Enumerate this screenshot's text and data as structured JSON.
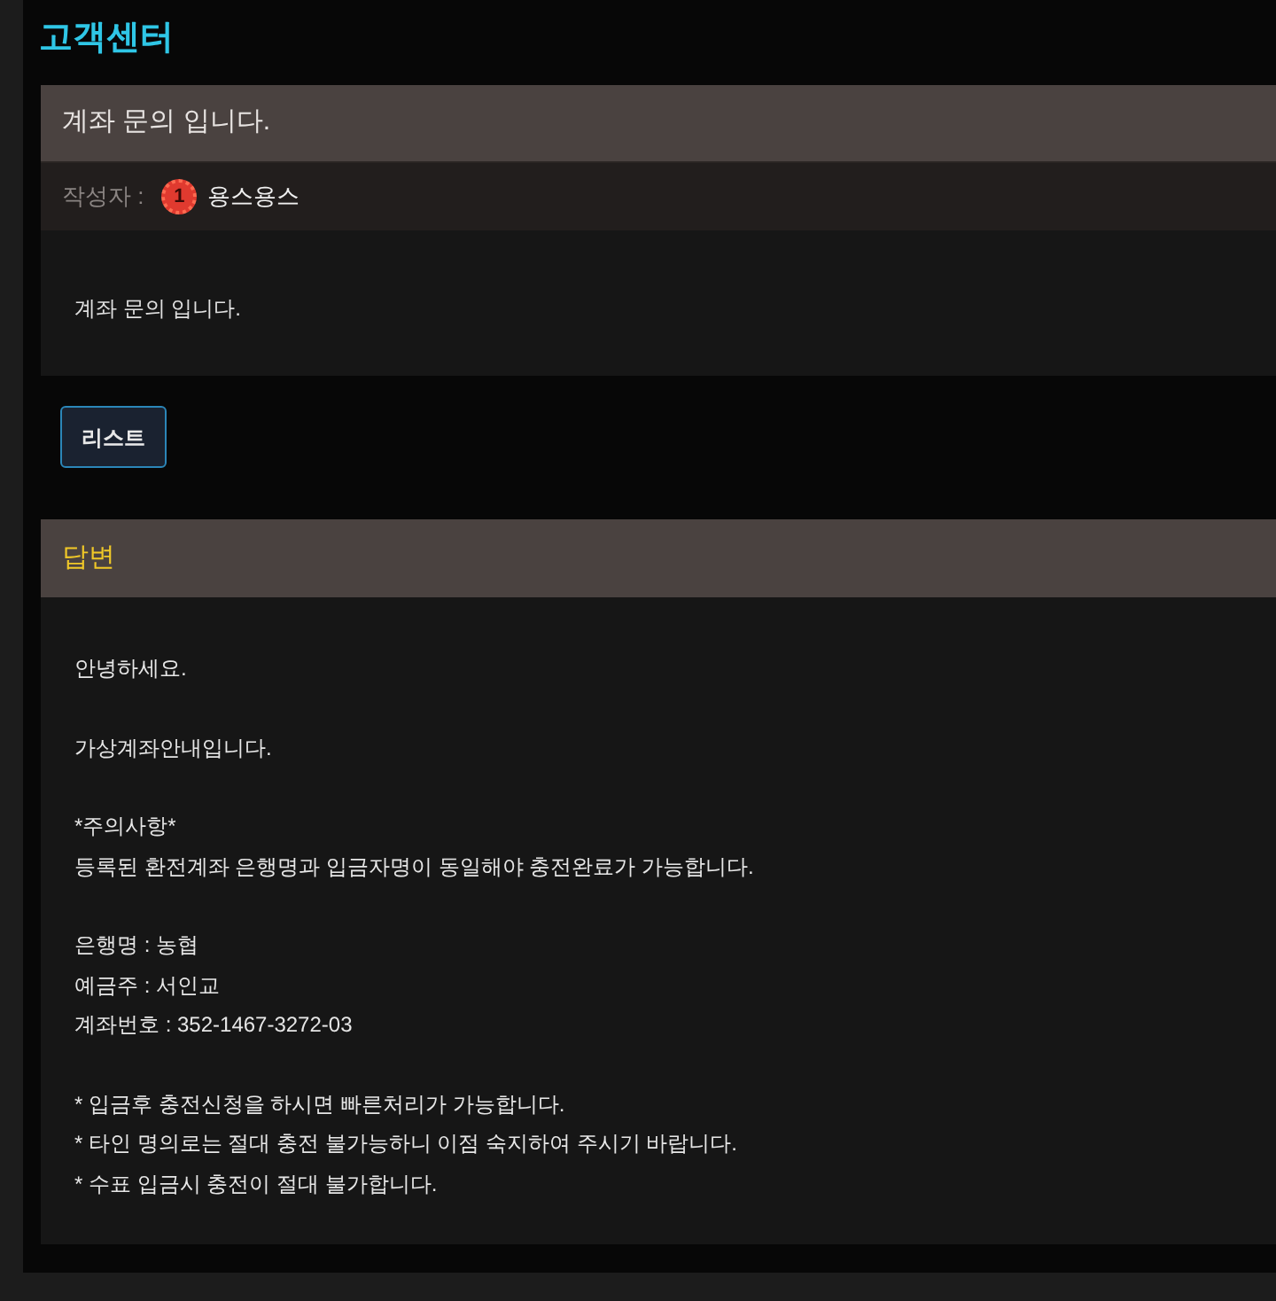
{
  "page_title": "고객센터",
  "post": {
    "title": "계좌 문의 입니다.",
    "author_label": "작성자 :",
    "author_level": "1",
    "author_name": "용스용스",
    "body": "계좌 문의 입니다."
  },
  "list_button": "리스트",
  "answer": {
    "heading": "답변",
    "paragraphs": [
      [
        "안녕하세요."
      ],
      [
        "가상계좌안내입니다."
      ],
      [
        "*주의사항*",
        "등록된 환전계좌 은행명과 입금자명이 동일해야 충전완료가 가능합니다."
      ],
      [
        "은행명 : 농협",
        "예금주 : 서인교",
        "계좌번호 : 352-1467-3272-03"
      ],
      [
        "* 입금후 충전신청을 하시면 빠른처리가 가능합니다.",
        "* 타인 명의로는 절대 충전 불가능하니 이점 숙지하여 주시기 바랍니다.",
        "* 수표 입금시 충전이 절대 불가합니다."
      ]
    ]
  }
}
